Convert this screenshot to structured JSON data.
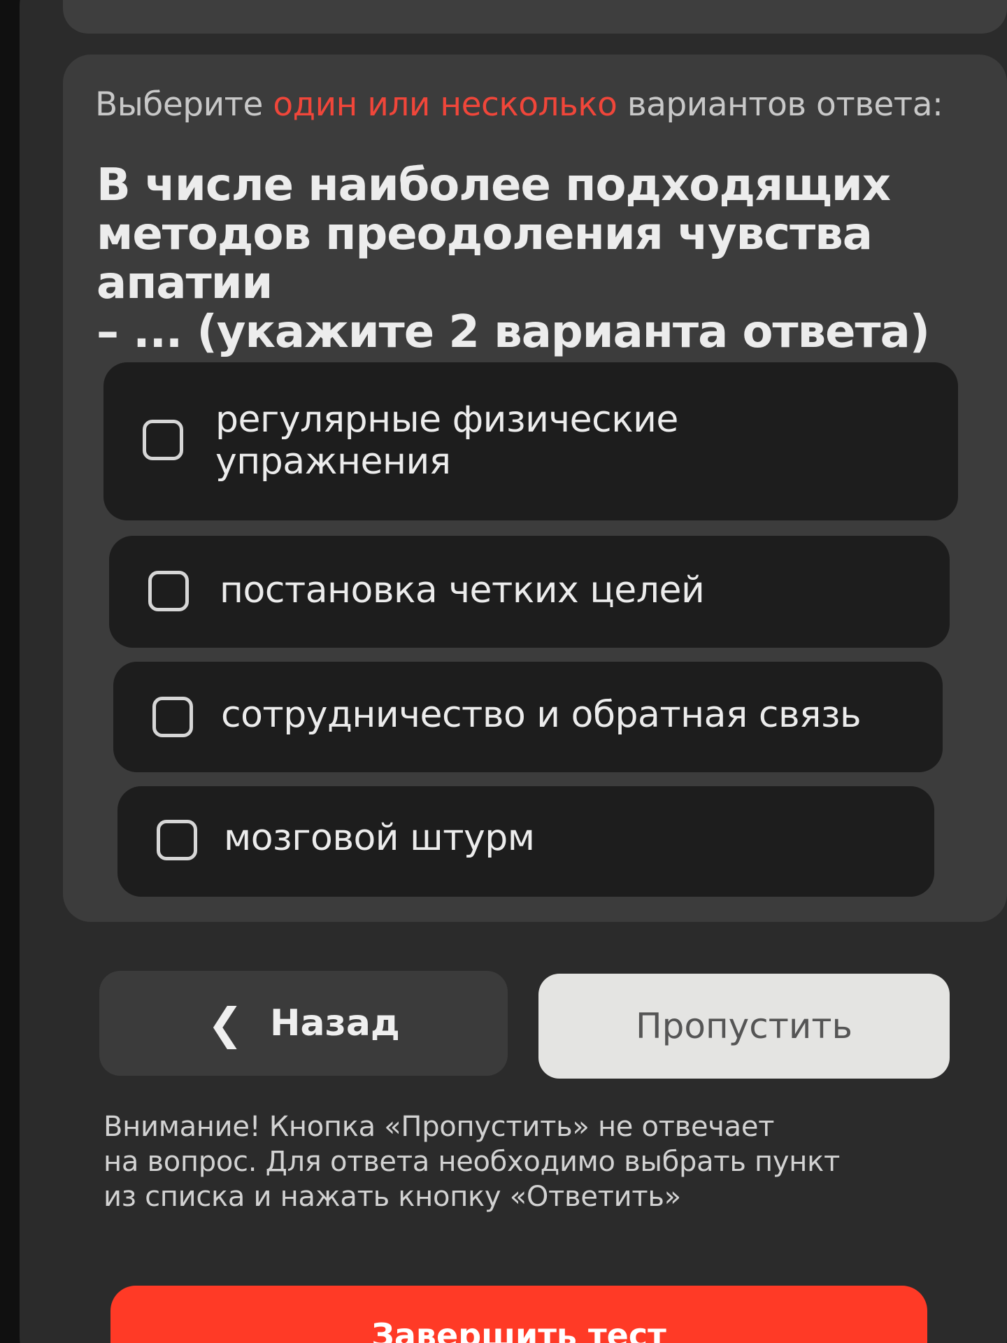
{
  "instruction": {
    "prefix": "Выберите ",
    "accent": "один или несколько",
    "suffix": " вариантов ответа:"
  },
  "question": {
    "line1": "В числе наиболее подходящих",
    "line2": "методов преодоления чувства апатии",
    "line3": "– ... (укажите 2 варианта ответа)"
  },
  "options": [
    {
      "line1": "регулярные физические",
      "line2": "упражнения",
      "checked": false
    },
    {
      "label": "постановка четких целей",
      "checked": false
    },
    {
      "label": "сотрудничество и обратная связь",
      "checked": false
    },
    {
      "label": "мозговой штурм",
      "checked": false
    }
  ],
  "buttons": {
    "back_icon": "chevron-left-icon",
    "back_label": "Назад",
    "skip_label": "Пропустить",
    "finish_label": "Завершить тест"
  },
  "notice": {
    "line1": "Внимание! Кнопка «Пропустить» не отвечает",
    "line2": "на вопрос. Для ответа необходимо выбрать пункт",
    "line3": "из списка и нажать кнопку «Ответить»"
  },
  "colors": {
    "accent": "#f0463a",
    "finish_button": "#ff3a26",
    "option_bg": "#1d1d1d",
    "card_bg": "#3c3c3c"
  }
}
